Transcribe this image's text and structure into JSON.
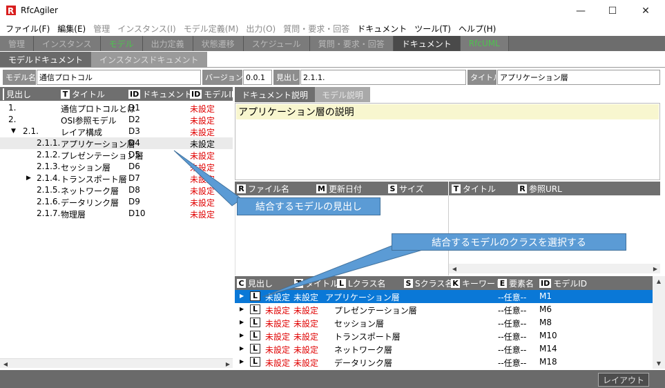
{
  "app": {
    "title": "RfcAgiler"
  },
  "window": {
    "minimize": "—",
    "maximize": "☐",
    "close": "✕"
  },
  "menu": [
    "ファイル(F)",
    "編集(E)",
    "管理",
    "インスタンス(I)",
    "モデル定義(M)",
    "出力(O)",
    "質問・要求・回答",
    "ドキュメント",
    "ツール(T)",
    "ヘルプ(H)"
  ],
  "main_tabs": [
    "管理",
    "インスタンス",
    "モデル",
    "出力定義",
    "状態遷移",
    "スケジュール",
    "質問・要求・回答",
    "ドキュメント",
    "RfcUML"
  ],
  "sub_tabs": [
    "モデルドキュメント",
    "インスタンスドキュメント"
  ],
  "fields": {
    "model_name_label": "モデル名",
    "model_name_value": "通信プロトコル",
    "version_label": "バージョン",
    "version_value": "0.0.1",
    "heading_label": "見出し",
    "heading_value": "2.1.1.",
    "title_label": "タイトル",
    "title_value": "アプリケーション層"
  },
  "tree": {
    "columns": {
      "heading": "見出し",
      "title_badge": "T",
      "title": "タイトル",
      "docid_badge": "ID",
      "docid": "ドキュメントID",
      "modelid_badge": "ID",
      "modelid": "モデルID"
    },
    "rows": [
      {
        "heading": "1.",
        "title": "通信プロトコルとは",
        "doc_id": "D1",
        "model_id": "未設定"
      },
      {
        "heading": "2.",
        "title": "OSI参照モデル",
        "doc_id": "D2",
        "model_id": "未設定"
      },
      {
        "heading": "2.1.",
        "title": "レイア構成",
        "doc_id": "D3",
        "model_id": "未設定"
      },
      {
        "heading": "2.1.1.",
        "title": "アプリケーション層",
        "doc_id": "D4",
        "model_id": "未設定"
      },
      {
        "heading": "2.1.2.",
        "title": "プレゼンテーション層",
        "doc_id": "D5",
        "model_id": "未設定"
      },
      {
        "heading": "2.1.3.",
        "title": "セッション層",
        "doc_id": "D6",
        "model_id": "未設定"
      },
      {
        "heading": "2.1.4.",
        "title": "トランスポート層",
        "doc_id": "D7",
        "model_id": "未設定"
      },
      {
        "heading": "2.1.5.",
        "title": "ネットワーク層",
        "doc_id": "D8",
        "model_id": "未設定"
      },
      {
        "heading": "2.1.6.",
        "title": "データリンク層",
        "doc_id": "D9",
        "model_id": "未設定"
      },
      {
        "heading": "2.1.7.",
        "title": "物理層",
        "doc_id": "D10",
        "model_id": "未設定"
      }
    ]
  },
  "desc_tabs": [
    "ドキュメント説明",
    "モデル説明"
  ],
  "description": "アプリケーション層の説明",
  "file_table": {
    "file_badge": "R",
    "file_name": "ファイル名",
    "updated_badge": "M",
    "updated": "更新日付",
    "size_badge": "S",
    "size": "サイズ"
  },
  "url_table": {
    "title_badge": "T",
    "title": "タイトル",
    "url_badge": "R",
    "url": "参照URL"
  },
  "class_table": {
    "columns": {
      "heading_badge": "C",
      "heading": "見出し",
      "title_badge": "T",
      "title": "タイトル",
      "lclass_badge": "L",
      "lclass": "Lクラス名",
      "sclass_badge": "S",
      "sclass": "Sクラス名",
      "keyword_badge": "K",
      "keyword": "キーワード",
      "element_badge": "E",
      "element": "要素名",
      "modelid_badge": "ID",
      "modelid": "モデルID"
    },
    "row_badge": "L",
    "rows": [
      {
        "heading": "未設定",
        "title": "未設定",
        "lclass": "アプリケーション層",
        "element": "--任意--",
        "model_id": "M1"
      },
      {
        "heading": "未設定",
        "title": "未設定",
        "lclass": "プレゼンテーション層",
        "element": "--任意--",
        "model_id": "M6"
      },
      {
        "heading": "未設定",
        "title": "未設定",
        "lclass": "セッション層",
        "element": "--任意--",
        "model_id": "M8"
      },
      {
        "heading": "未設定",
        "title": "未設定",
        "lclass": "トランスポート層",
        "element": "--任意--",
        "model_id": "M10"
      },
      {
        "heading": "未設定",
        "title": "未設定",
        "lclass": "ネットワーク層",
        "element": "--任意--",
        "model_id": "M14"
      },
      {
        "heading": "未設定",
        "title": "未設定",
        "lclass": "データリンク層",
        "element": "--任意--",
        "model_id": "M18"
      }
    ]
  },
  "callouts": {
    "model_heading": "結合するモデルの見出し",
    "model_class": "結合するモデルのクラスを選択する"
  },
  "footer": {
    "layout_button": "レイアウト"
  },
  "colors": {
    "accent_blue": "#0a78d7",
    "callout_blue": "#5b9bd5",
    "status_red": "#e00000",
    "tab_green": "#4fc24f"
  }
}
